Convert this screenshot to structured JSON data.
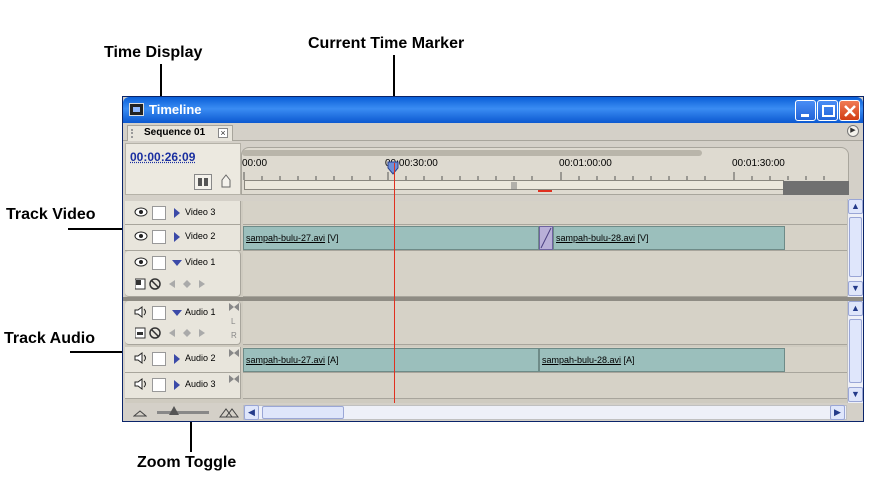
{
  "callouts": {
    "time_display": "Time Display",
    "current_time_marker": "Current Time Marker",
    "track_video": "Track Video",
    "track_audio": "Track Audio",
    "zoom_toggle": "Zoom Toggle"
  },
  "window": {
    "title": "Timeline",
    "tab_label": "Sequence 01",
    "tab_close": "×",
    "timecode": "00:00:26:09"
  },
  "ruler": {
    "labels": [
      "00:00",
      "00:00:30:00",
      "00:01:00:00",
      "00:01:30:00"
    ]
  },
  "video_tracks": [
    {
      "name": "Video 3",
      "expanded": false
    },
    {
      "name": "Video 2",
      "expanded": false
    },
    {
      "name": "Video 1",
      "expanded": true
    }
  ],
  "audio_tracks": [
    {
      "name": "Audio 1",
      "expanded": true,
      "channels": [
        "L",
        "R"
      ]
    },
    {
      "name": "Audio 2",
      "expanded": false
    },
    {
      "name": "Audio 3",
      "expanded": false
    }
  ],
  "clips": {
    "video2_a": {
      "name": "sampah-bulu-27.avi",
      "tag": " [V]"
    },
    "video2_b": {
      "name": "sampah-bulu-28.avi",
      "tag": " [V]"
    },
    "audio2_a": {
      "name": "sampah-bulu-27.avi",
      "tag": " [A]"
    },
    "audio2_b": {
      "name": "sampah-bulu-28.avi",
      "tag": " [A]"
    }
  },
  "colors": {
    "title_bar": "#0a5fd8",
    "clip": "#9bbfbc",
    "transition": "#b9b0d8",
    "playhead": "#e03020",
    "timecode": "#1a2fa0"
  }
}
